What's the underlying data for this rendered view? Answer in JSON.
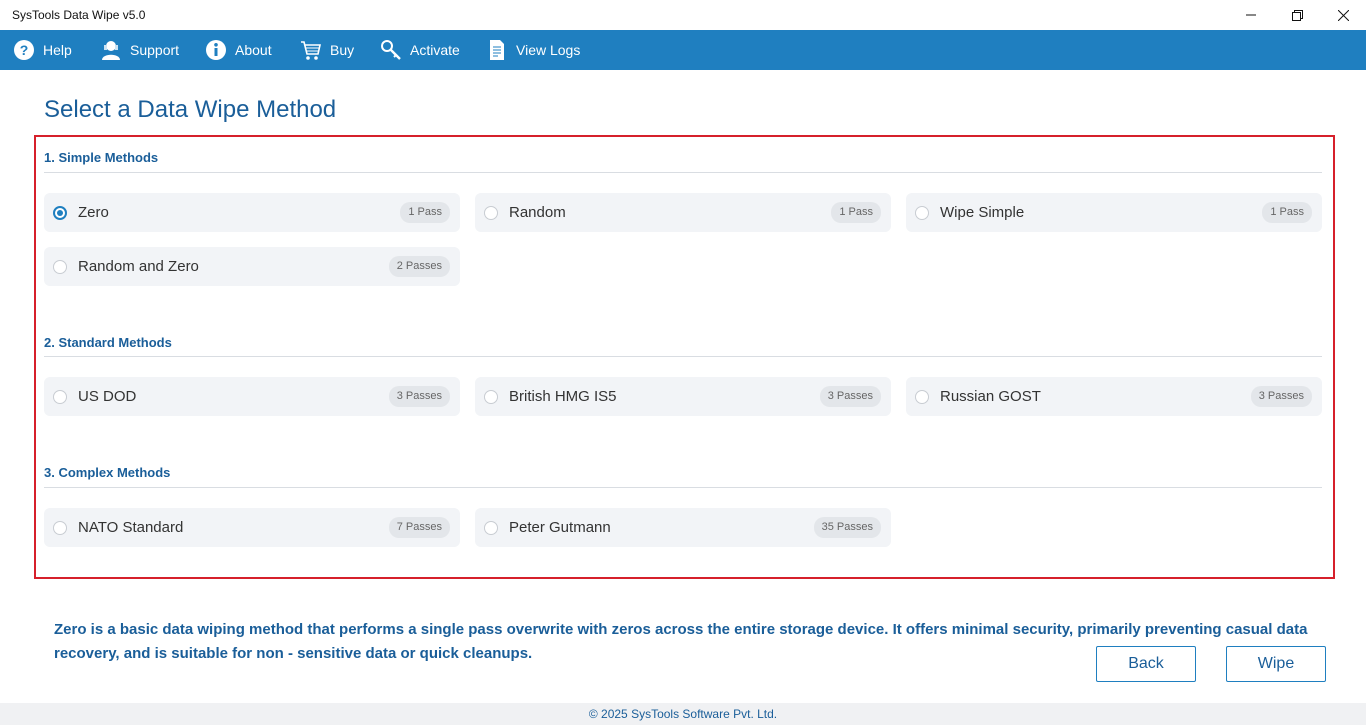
{
  "window": {
    "title": "SysTools Data Wipe v5.0"
  },
  "menu": [
    {
      "label": "Help",
      "icon": "help-icon"
    },
    {
      "label": "Support",
      "icon": "support-icon"
    },
    {
      "label": "About",
      "icon": "info-icon"
    },
    {
      "label": "Buy",
      "icon": "cart-icon"
    },
    {
      "label": "Activate",
      "icon": "key-icon"
    },
    {
      "label": "View Logs",
      "icon": "document-icon"
    }
  ],
  "page_title": "Select a Data Wipe Method",
  "sections": [
    {
      "title": "1. Simple Methods",
      "options": [
        {
          "label": "Zero",
          "passes": "1 Pass",
          "selected": true
        },
        {
          "label": "Random",
          "passes": "1 Pass",
          "selected": false
        },
        {
          "label": "Wipe Simple",
          "passes": "1 Pass",
          "selected": false
        },
        {
          "label": "Random and Zero",
          "passes": "2 Passes",
          "selected": false
        }
      ]
    },
    {
      "title": "2. Standard Methods",
      "options": [
        {
          "label": "US DOD",
          "passes": "3 Passes",
          "selected": false
        },
        {
          "label": "British HMG IS5",
          "passes": "3 Passes",
          "selected": false
        },
        {
          "label": "Russian GOST",
          "passes": "3 Passes",
          "selected": false
        }
      ]
    },
    {
      "title": "3. Complex Methods",
      "options": [
        {
          "label": "NATO Standard",
          "passes": "7 Passes",
          "selected": false
        },
        {
          "label": "Peter Gutmann",
          "passes": "35 Passes",
          "selected": false
        }
      ]
    }
  ],
  "description": "Zero is a basic data wiping method that performs a single pass overwrite with zeros across the entire storage device. It offers minimal security, primarily preventing casual data recovery, and is suitable for non - sensitive data or quick cleanups.",
  "buttons": {
    "back": "Back",
    "wipe": "Wipe"
  },
  "footer": "© 2025 SysTools Software Pvt. Ltd.",
  "colors": {
    "accent": "#1f7fc0",
    "heading": "#1a5e99",
    "frame_border": "#d6202b"
  }
}
